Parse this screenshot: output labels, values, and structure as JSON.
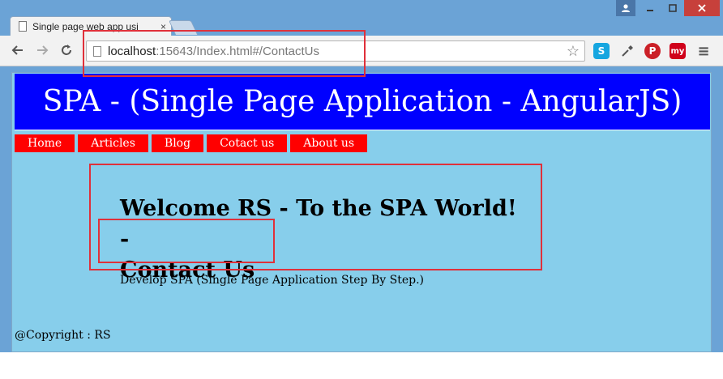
{
  "browser": {
    "tab_title": "Single page web app usi",
    "tab_close": "×",
    "url_host": "localhost",
    "url_rest": ":15643/Index.html#/ContactUs",
    "extensions": [
      {
        "name": "skype-icon",
        "label": "S",
        "color": "#16a6e0"
      },
      {
        "name": "eyedropper-icon",
        "label": "",
        "color": "#555555"
      },
      {
        "name": "pinterest-icon",
        "label": "P",
        "color": "#cb2027"
      },
      {
        "name": "mywot-icon",
        "label": "my",
        "color": "#d0021b"
      }
    ]
  },
  "page": {
    "banner_title": "SPA - (Single Page Application - AngularJS)",
    "menu": [
      "Home",
      "Articles",
      "Blog",
      "Cotact us",
      "About us"
    ],
    "welcome_line1": "Welcome RS - To the SPA World! -",
    "welcome_line2": "Contact Us",
    "description": "Develop SPA (Single Page Application Step By Step.)",
    "footer": "@Copyright : RS"
  },
  "colors": {
    "banner": "#0000ff",
    "menu": "#ff0000",
    "page_bg": "#87ceeb",
    "annotation": "#e0303a"
  }
}
